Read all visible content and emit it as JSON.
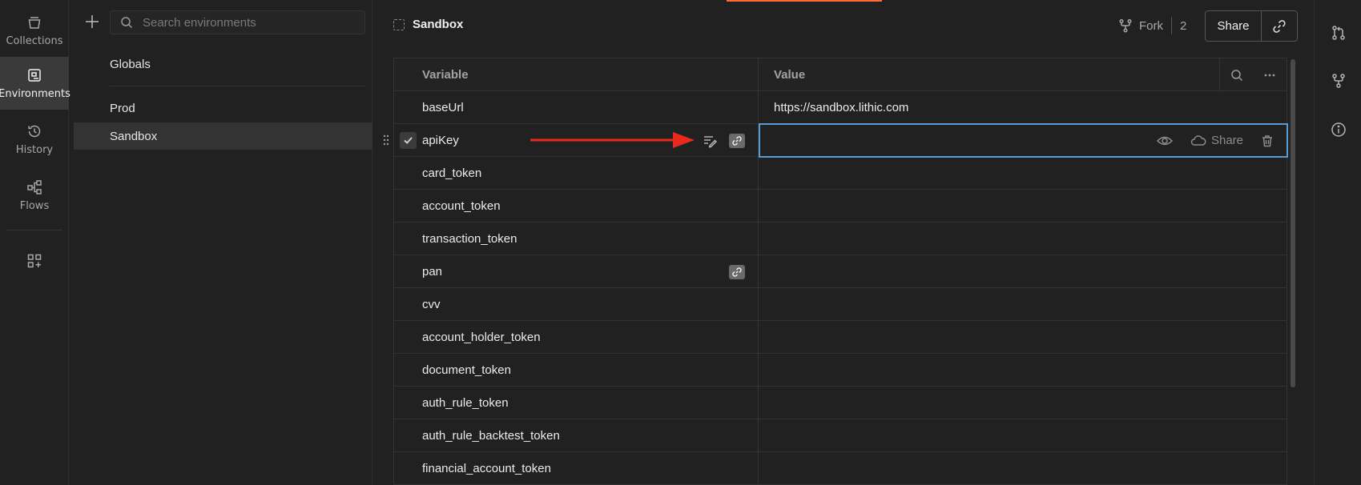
{
  "nav": {
    "items": [
      {
        "label": "Collections",
        "icon": "collections-icon"
      },
      {
        "label": "Environments",
        "icon": "environments-icon",
        "active": true
      },
      {
        "label": "History",
        "icon": "history-icon"
      },
      {
        "label": "Flows",
        "icon": "flows-icon"
      }
    ],
    "extra_icon": "add-widgets-icon"
  },
  "env_panel": {
    "search_placeholder": "Search environments",
    "globals": "Globals",
    "environments": [
      {
        "label": "Prod",
        "active": false
      },
      {
        "label": "Sandbox",
        "active": true
      }
    ]
  },
  "main": {
    "title": "Sandbox",
    "fork_label": "Fork",
    "fork_count": "2",
    "share_label": "Share"
  },
  "table": {
    "headers": {
      "variable": "Variable",
      "value": "Value"
    },
    "rows": [
      {
        "variable": "baseUrl",
        "value": "https://sandbox.lithic.com"
      },
      {
        "variable": "apiKey",
        "value": "",
        "checked": true,
        "secret": true,
        "selected": true
      },
      {
        "variable": "card_token",
        "value": ""
      },
      {
        "variable": "account_token",
        "value": ""
      },
      {
        "variable": "transaction_token",
        "value": ""
      },
      {
        "variable": "pan",
        "value": "",
        "secret": true
      },
      {
        "variable": "cvv",
        "value": ""
      },
      {
        "variable": "account_holder_token",
        "value": ""
      },
      {
        "variable": "document_token",
        "value": ""
      },
      {
        "variable": "auth_rule_token",
        "value": ""
      },
      {
        "variable": "auth_rule_backtest_token",
        "value": ""
      },
      {
        "variable": "financial_account_token",
        "value": ""
      }
    ],
    "value_actions": {
      "share_label": "Share"
    }
  },
  "colors": {
    "accent": "#ff6c37",
    "focus": "#5b9bd5",
    "annotation_arrow": "#e8291c"
  }
}
